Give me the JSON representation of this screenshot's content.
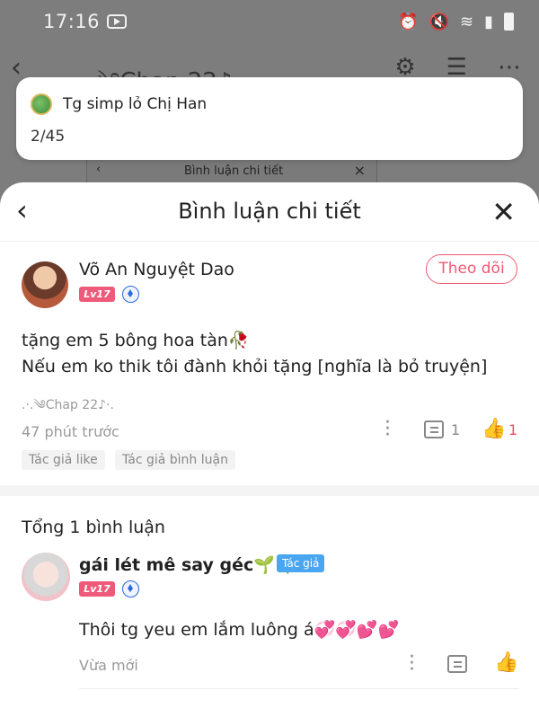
{
  "status_bar": {
    "time": "17:16",
    "icons": [
      "alarm-icon",
      "mute-icon",
      "wifi-icon",
      "signal-icon",
      "battery-icon"
    ]
  },
  "background": {
    "nav": {
      "title": "·.༄Chap 22♪·.",
      "icons": [
        "back-arrow-icon",
        "gear-icon",
        "list-icon",
        "more-icon"
      ]
    },
    "mini_sheet_title": "Bình luận chi tiết"
  },
  "notification": {
    "title": "Tg simp lỏ Chị Han",
    "count": "2/45"
  },
  "sheet": {
    "title": "Bình luận chi tiết",
    "main_comment": {
      "username": "Võ An Nguyệt Dao",
      "level": "Lv17",
      "follow_label": "Theo dõi",
      "lines": [
        "tặng em 5 bông hoa tàn🥀",
        "Nếu em ko thik tôi đành khỏi tặng [nghĩa là bỏ truyện]"
      ],
      "chapter_ref": ".·.༄Chap 22♪·.",
      "time": "47 phút trước",
      "reply_count": "1",
      "like_count": "1",
      "badges": [
        "Tác giả like",
        "Tác giả bình luận"
      ]
    },
    "total_label": "Tổng 1 bình luận",
    "reply": {
      "username": "gái lét mê say géc🌱🍀",
      "author_tag": "Tác giả",
      "level": "Lv17",
      "text": "Thôi tg yeu em lắm luông á💞💞💕💕",
      "time": "Vừa mới"
    }
  },
  "colors": {
    "accent": "#ef5a73",
    "author_tag": "#4aa6f0",
    "level_badge": "#f05a7a"
  }
}
